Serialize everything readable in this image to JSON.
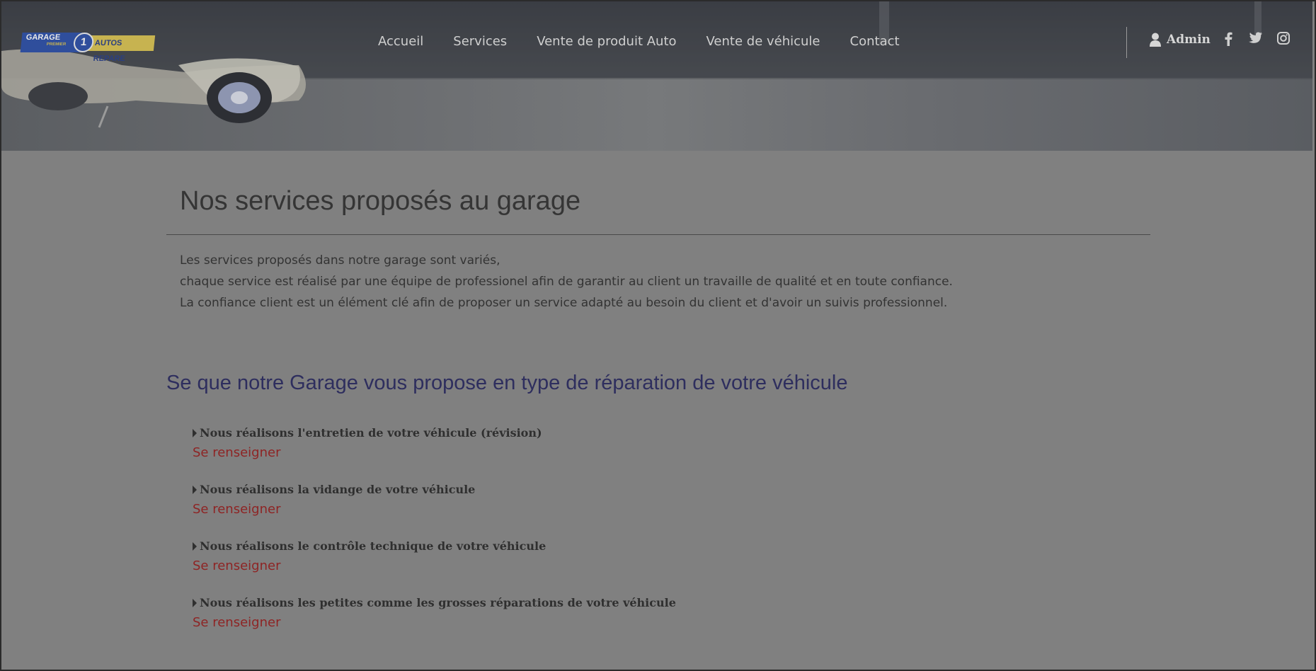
{
  "brand": {
    "logo_left": "GARAGE",
    "logo_sub": "PREMIER",
    "logo_number": "1",
    "logo_right": "AUTOS REPARE"
  },
  "nav": {
    "items": [
      "Accueil",
      "Services",
      "Vente de produit Auto",
      "Vente de véhicule",
      "Contact"
    ]
  },
  "account": {
    "label": "Admin"
  },
  "social": [
    "facebook-icon",
    "twitter-icon",
    "instagram-icon"
  ],
  "page": {
    "title": "Nos services proposés au garage",
    "intro": [
      "Les services proposés dans notre garage sont variés,",
      "chaque service est réalisé par une équipe de professionel afin de garantir au client un travaille de qualité et en toute confiance.",
      "La confiance client est un élément clé afin de proposer un service adapté au besoin du client et d'avoir un suivis professionnel."
    ],
    "section_title": "Se que notre Garage vous propose en type de réparation de votre véhicule",
    "services": [
      {
        "title": "Nous réalisons l'entretien de votre véhicule (révision)",
        "link": "Se renseigner"
      },
      {
        "title": "Nous réalisons la vidange de votre véhicule",
        "link": "Se renseigner"
      },
      {
        "title": "Nous réalisons le contrôle technique de votre véhicule",
        "link": "Se renseigner"
      },
      {
        "title": "Nous réalisons les petites comme les grosses réparations de votre véhicule",
        "link": "Se renseigner"
      }
    ]
  },
  "colors": {
    "overlay_bg": "#808080",
    "title_text": "#353535",
    "section_title": "#2e2e5e",
    "link": "#8e2424"
  }
}
